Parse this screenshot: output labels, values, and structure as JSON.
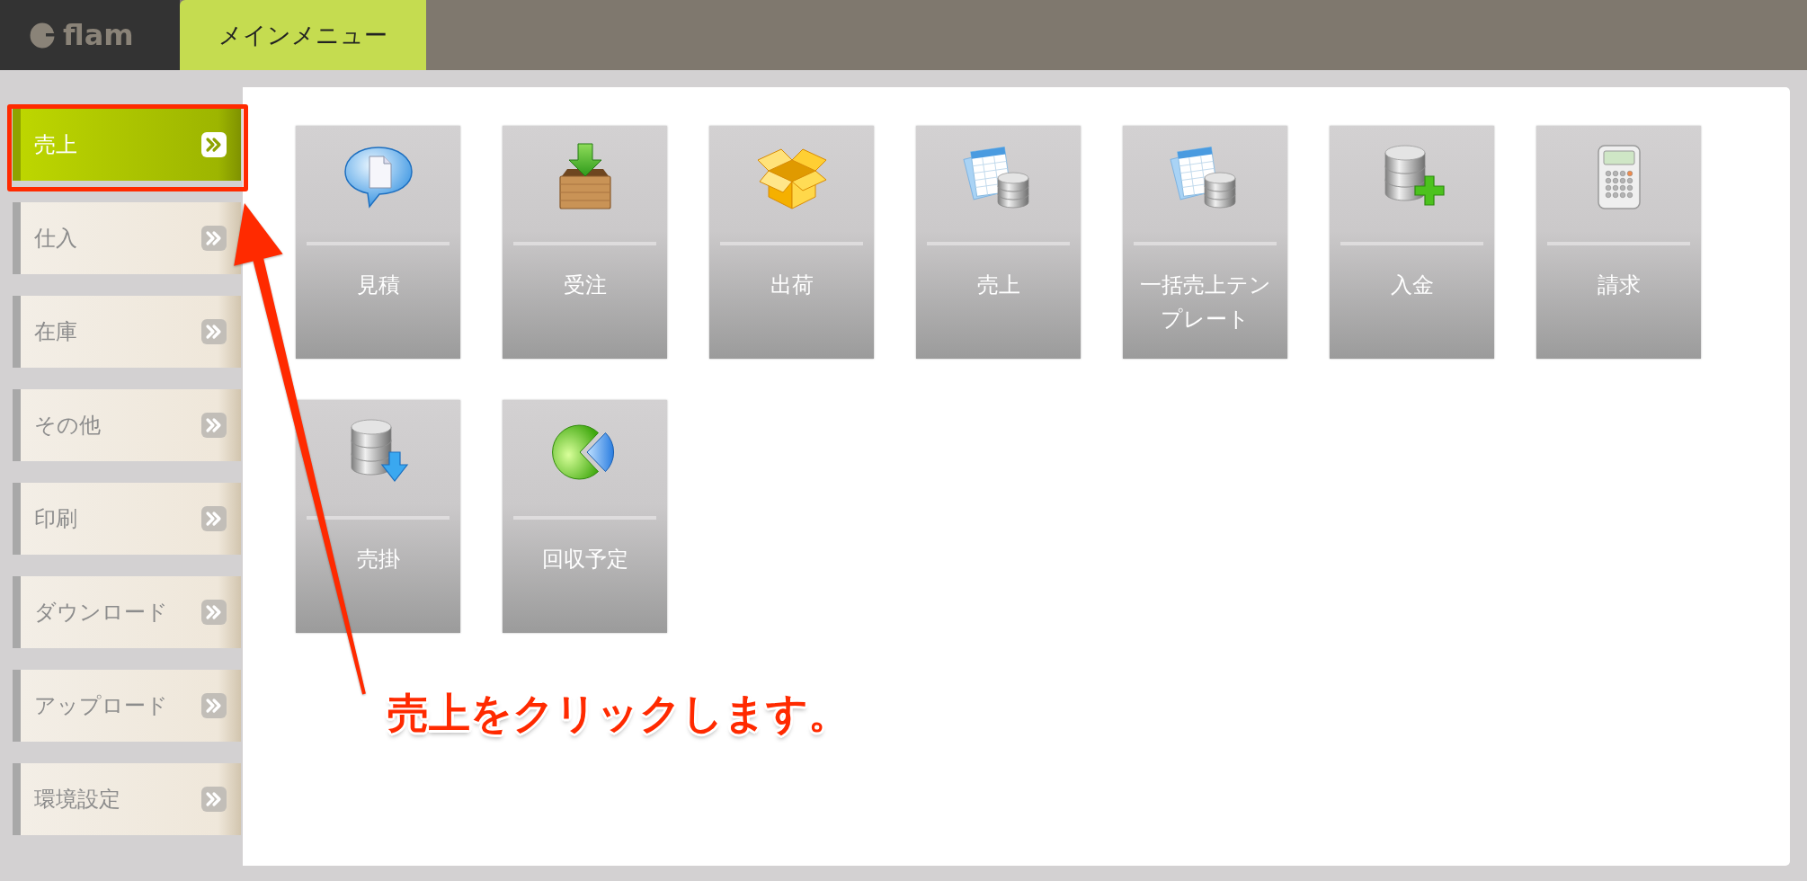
{
  "header": {
    "logo_text": "flam",
    "tabs": [
      {
        "label": "メインメニュー",
        "selected": true
      }
    ]
  },
  "sidebar": {
    "items": [
      {
        "label": "売上",
        "selected": true,
        "highlighted": true
      },
      {
        "label": "仕入",
        "selected": false,
        "highlighted": false
      },
      {
        "label": "在庫",
        "selected": false,
        "highlighted": false
      },
      {
        "label": "その他",
        "selected": false,
        "highlighted": false
      },
      {
        "label": "印刷",
        "selected": false,
        "highlighted": false
      },
      {
        "label": "ダウンロード",
        "selected": false,
        "highlighted": false
      },
      {
        "label": "アップロード",
        "selected": false,
        "highlighted": false
      },
      {
        "label": "環境設定",
        "selected": false,
        "highlighted": false
      }
    ]
  },
  "menu_tiles": [
    {
      "label": "見積"
    },
    {
      "label": "受注"
    },
    {
      "label": "出荷"
    },
    {
      "label": "売上"
    },
    {
      "label": "一括売上テンプレート"
    },
    {
      "label": "入金"
    },
    {
      "label": "請求"
    },
    {
      "label": "売掛"
    },
    {
      "label": "回収予定"
    }
  ],
  "annotation": {
    "text": "売上をクリックします。"
  }
}
